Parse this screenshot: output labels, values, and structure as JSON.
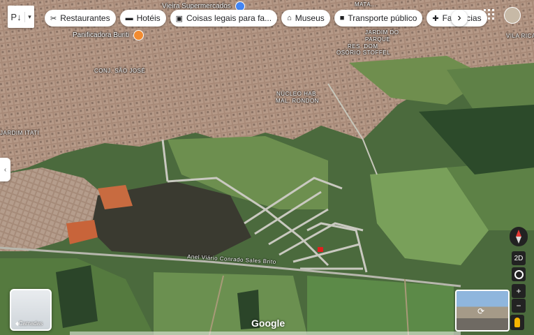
{
  "pegman_menu": {
    "label": "P↓"
  },
  "chips": [
    {
      "icon": "✂",
      "label": "Restaurantes",
      "name": "chip-restaurantes"
    },
    {
      "icon": "▬",
      "label": "Hotéis",
      "name": "chip-hoteis"
    },
    {
      "icon": "▣",
      "label": "Coisas legais para fa...",
      "name": "chip-coisas-legais"
    },
    {
      "icon": "⌂",
      "label": "Museus",
      "name": "chip-museus"
    },
    {
      "icon": "■",
      "label": "Transporte público",
      "name": "chip-transporte"
    },
    {
      "icon": "✚",
      "label": "Farmácias",
      "name": "chip-farmacias"
    }
  ],
  "chip_next": "›",
  "side_tab": "‹",
  "layers": {
    "label": "Camadas"
  },
  "poi": {
    "supermarket": "Vieira Supermercados",
    "bakery": "Panificadora Buriti"
  },
  "place_labels": {
    "jardim_do_parque_1": "JARDIM DO",
    "jardim_do_parque_2": "PARQUE",
    "res_dom_1": "RES. DOM",
    "res_dom_2": "OSÓRIO STOFFEL",
    "conj_sao_jose": "CONJ. SÃO JOSÉ",
    "nucleo_1": "NÚCLEO HAB.",
    "nucleo_2": "MAL. RONDON",
    "jardim_itati": "JARDIM ITATI",
    "vila_rica": "VILA RICA",
    "mata": "MATA..."
  },
  "road_label": "Anel Viário Conrado Sales Brito",
  "controls": {
    "mode": "2D",
    "zoom_in": "+",
    "zoom_out": "−"
  },
  "brand": "Google",
  "colors": {
    "pin_orange": "#f28b30",
    "pin_blue": "#4285f4",
    "marker_red": "#e02020"
  }
}
